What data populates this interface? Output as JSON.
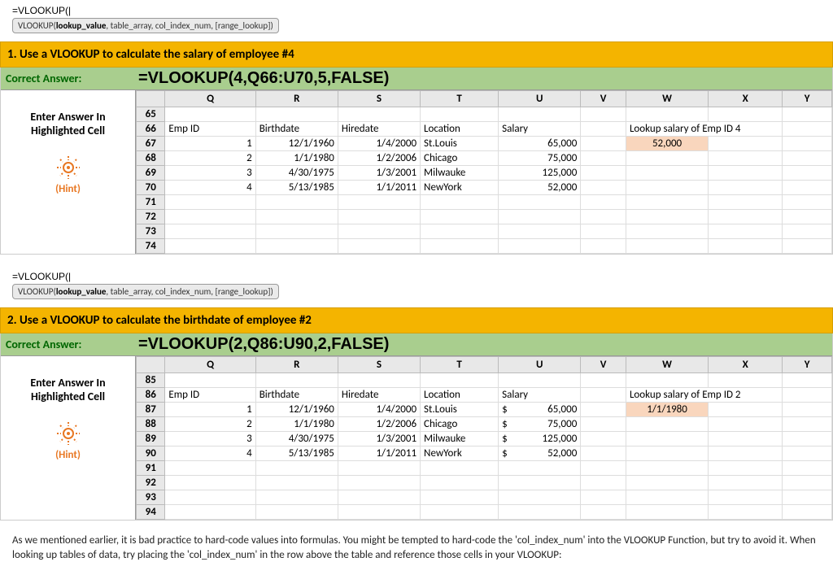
{
  "formula_bar": {
    "text": "=VLOOKUP(",
    "tooltip_prefix": "VLOOKUP(",
    "tooltip_bold": "lookup_value",
    "tooltip_rest": ", table_array, col_index_num, [range_lookup])"
  },
  "problems": [
    {
      "title": "1. Use a VLOOKUP to calculate the salary of employee #4",
      "correct_label": "Correct Answer:",
      "answer": "=VLOOKUP(4,Q66:U70,5,FALSE)",
      "enter_line1": "Enter Answer In",
      "enter_line2": "Highlighted Cell",
      "hint": "(Hint)",
      "cols": [
        "Q",
        "R",
        "S",
        "T",
        "U",
        "V",
        "W",
        "X",
        "Y"
      ],
      "row_start": 65,
      "row_end": 74,
      "headers_row": 66,
      "headers": {
        "Q": "Emp ID",
        "R": "Birthdate",
        "S": "Hiredate",
        "T": "Location",
        "U": "Salary",
        "W": "Lookup salary of Emp ID 4"
      },
      "data": [
        {
          "row": 67,
          "Q": "1",
          "R": "12/1/1960",
          "S": "1/4/2000",
          "T": "St.Louis",
          "U": "65,000"
        },
        {
          "row": 68,
          "Q": "2",
          "R": "1/1/1980",
          "S": "1/2/2006",
          "T": "Chicago",
          "U": "75,000"
        },
        {
          "row": 69,
          "Q": "3",
          "R": "4/30/1975",
          "S": "1/3/2001",
          "T": "Milwauke",
          "U": "125,000"
        },
        {
          "row": 70,
          "Q": "4",
          "R": "5/13/1985",
          "S": "1/1/2011",
          "T": "NewYork",
          "U": "52,000"
        }
      ],
      "highlight": {
        "row": 67,
        "col": "W",
        "value": "52,000"
      },
      "dollar": false
    },
    {
      "title": "2. Use a VLOOKUP to calculate the birthdate of employee #2",
      "correct_label": "Correct Answer:",
      "answer": "=VLOOKUP(2,Q86:U90,2,FALSE)",
      "enter_line1": "Enter Answer In",
      "enter_line2": "Highlighted Cell",
      "hint": "(Hint)",
      "cols": [
        "Q",
        "R",
        "S",
        "T",
        "U",
        "V",
        "W",
        "X",
        "Y"
      ],
      "row_start": 85,
      "row_end": 94,
      "headers_row": 86,
      "headers": {
        "Q": "Emp ID",
        "R": "Birthdate",
        "S": "Hiredate",
        "T": "Location",
        "U": "Salary",
        "W": "Lookup salary of Emp ID 2"
      },
      "data": [
        {
          "row": 87,
          "Q": "1",
          "R": "12/1/1960",
          "S": "1/4/2000",
          "T": "St.Louis",
          "U": "65,000"
        },
        {
          "row": 88,
          "Q": "2",
          "R": "1/1/1980",
          "S": "1/2/2006",
          "T": "Chicago",
          "U": "75,000"
        },
        {
          "row": 89,
          "Q": "3",
          "R": "4/30/1975",
          "S": "1/3/2001",
          "T": "Milwauke",
          "U": "125,000"
        },
        {
          "row": 90,
          "Q": "4",
          "R": "5/13/1985",
          "S": "1/1/2011",
          "T": "NewYork",
          "U": "52,000"
        }
      ],
      "highlight": {
        "row": 87,
        "col": "W",
        "value": "1/1/1980"
      },
      "dollar": true
    }
  ],
  "footer": "As we mentioned earlier, it is bad practice to hard-code values into formulas. You might be tempted to hard-code the 'col_index_num' into the VLOOKUP Function, but try to avoid it. When looking up tables of data, try placing the 'col_index_num' in the row above the table and reference those cells in your VLOOKUP:"
}
